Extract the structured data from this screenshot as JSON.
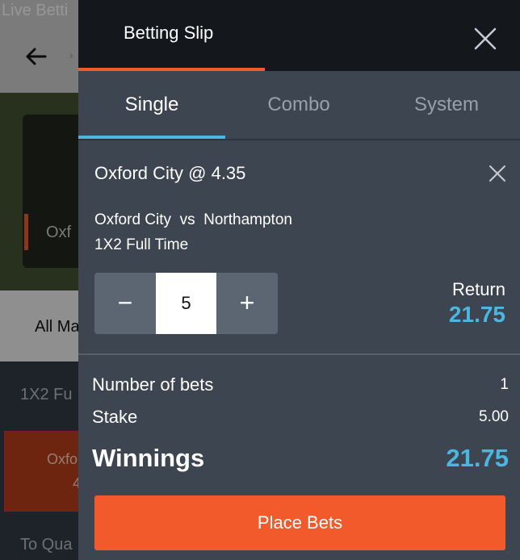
{
  "background": {
    "live_betting": "Live Betti",
    "team_partial": "Oxf",
    "all_markets_partial": "All Ma",
    "market_partial": "1X2 Fu",
    "odds_name_partial": "Oxfo",
    "odds_value_partial": "4",
    "qualify_partial": "To Qua"
  },
  "slip": {
    "title": "Betting Slip",
    "tabs": [
      {
        "label": "Single",
        "active": true
      },
      {
        "label": "Combo",
        "active": false
      },
      {
        "label": "System",
        "active": false
      }
    ],
    "selection": {
      "title": "Oxford City @  4.35",
      "match": "Oxford City  vs  Northampton",
      "market": "1X2 Full Time",
      "stake_value": "5",
      "minus_label": "−",
      "plus_label": "+",
      "return_label": "Return",
      "return_value": "21.75"
    },
    "summary": {
      "bets_label": "Number of bets",
      "bets_value": "1",
      "stake_label": "Stake",
      "stake_value": "5.00",
      "winnings_label": "Winnings",
      "winnings_value": "21.75"
    },
    "place_bets_label": "Place Bets"
  },
  "colors": {
    "accent_orange": "#f25a2b",
    "accent_blue": "#4bb6e1",
    "panel_bg": "#3c4550",
    "header_bg": "#14171c"
  }
}
